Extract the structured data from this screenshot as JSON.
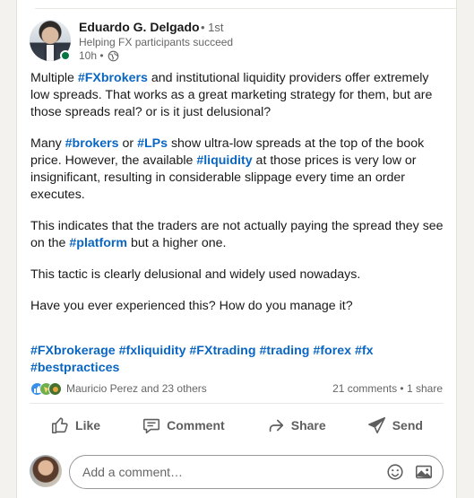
{
  "author": {
    "name": "Eduardo G. Delgado",
    "degree": "• 1st",
    "headline": "Helping FX participants succeed",
    "time": "10h •"
  },
  "post": {
    "p1": [
      {
        "t": "Multiple ",
        "tag": false
      },
      {
        "t": "#FXbrokers",
        "tag": true
      },
      {
        "t": " and institutional liquidity providers offer extremely low spreads. That works as a great marketing strategy for them, but are those spreads real? or is it just delusional?",
        "tag": false
      }
    ],
    "p2": [
      {
        "t": "Many ",
        "tag": false
      },
      {
        "t": "#brokers",
        "tag": true
      },
      {
        "t": " or ",
        "tag": false
      },
      {
        "t": "#LPs",
        "tag": true
      },
      {
        "t": " show ultra-low spreads at the top of the book price. However, the available ",
        "tag": false
      },
      {
        "t": "#liquidity",
        "tag": true
      },
      {
        "t": " at those prices is very low or insignificant, resulting in considerable slippage every time an order executes.",
        "tag": false
      }
    ],
    "p3": [
      {
        "t": "This indicates that the traders are not actually paying the spread they see on the ",
        "tag": false
      },
      {
        "t": "#platform",
        "tag": true
      },
      {
        "t": " but a higher one.",
        "tag": false
      }
    ],
    "p4": "This tactic is clearly delusional and widely used nowadays.",
    "p5": "Have you ever experienced this? How do you manage it?",
    "hashtags": [
      "#FXbrokerage",
      "#fxliquidity",
      "#FXtrading",
      "#trading",
      "#forex",
      "#fx",
      "#bestpractices"
    ]
  },
  "social": {
    "reactors": "Mauricio Perez and 23 others",
    "counts": "21 comments • 1 share"
  },
  "actions": {
    "like": "Like",
    "comment": "Comment",
    "share": "Share",
    "send": "Send"
  },
  "comment_box": {
    "placeholder": "Add a comment…"
  },
  "colors": {
    "link": "#0a66c2",
    "online": "#057642"
  }
}
